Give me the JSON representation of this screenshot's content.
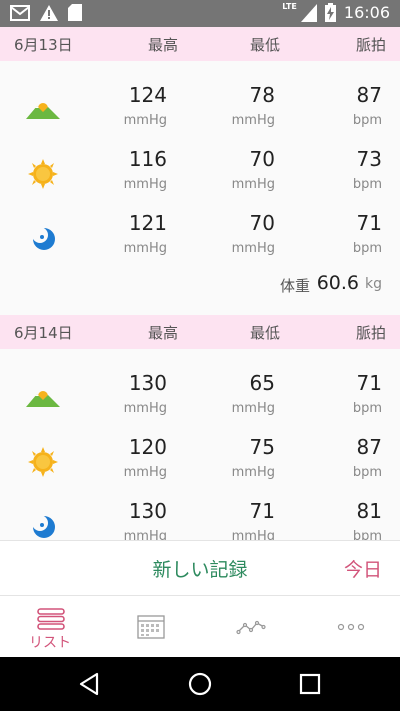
{
  "status_bar": {
    "network": "LTE",
    "time": "16:06",
    "icons": [
      "mail-icon",
      "warning-icon",
      "sd-card-icon",
      "signal-icon",
      "battery-charging-icon"
    ]
  },
  "columns": {
    "max": "最高",
    "min": "最低",
    "pulse": "脈拍"
  },
  "units": {
    "pressure": "mmHg",
    "pulse": "bpm",
    "weight": "kg"
  },
  "weight_label": "体重",
  "days": [
    {
      "date": "6月13日",
      "readings": [
        {
          "period_icon": "morning-mountain-icon",
          "max": "124",
          "min": "78",
          "pulse": "87"
        },
        {
          "period_icon": "daytime-sun-icon",
          "max": "116",
          "min": "70",
          "pulse": "73"
        },
        {
          "period_icon": "night-moon-icon",
          "max": "121",
          "min": "70",
          "pulse": "71"
        }
      ],
      "weight": "60.6"
    },
    {
      "date": "6月14日",
      "readings": [
        {
          "period_icon": "morning-mountain-icon",
          "max": "130",
          "min": "65",
          "pulse": "71"
        },
        {
          "period_icon": "daytime-sun-icon",
          "max": "120",
          "min": "75",
          "pulse": "87"
        },
        {
          "period_icon": "night-moon-icon",
          "max": "130",
          "min": "71",
          "pulse": "81"
        }
      ]
    }
  ],
  "action_bar": {
    "new_record": "新しい記録",
    "today": "今日"
  },
  "bottom_nav": {
    "tabs": [
      {
        "label": "リスト",
        "icon": "list-icon",
        "active": true
      },
      {
        "label": "",
        "icon": "calendar-icon",
        "active": false
      },
      {
        "label": "",
        "icon": "graph-icon",
        "active": false
      },
      {
        "label": "",
        "icon": "more-icon",
        "active": false
      }
    ]
  },
  "colors": {
    "accent_pink": "#d2547a",
    "header_pink": "#fde3f1",
    "green": "#2d8a5e",
    "status_bar": "#757575"
  }
}
